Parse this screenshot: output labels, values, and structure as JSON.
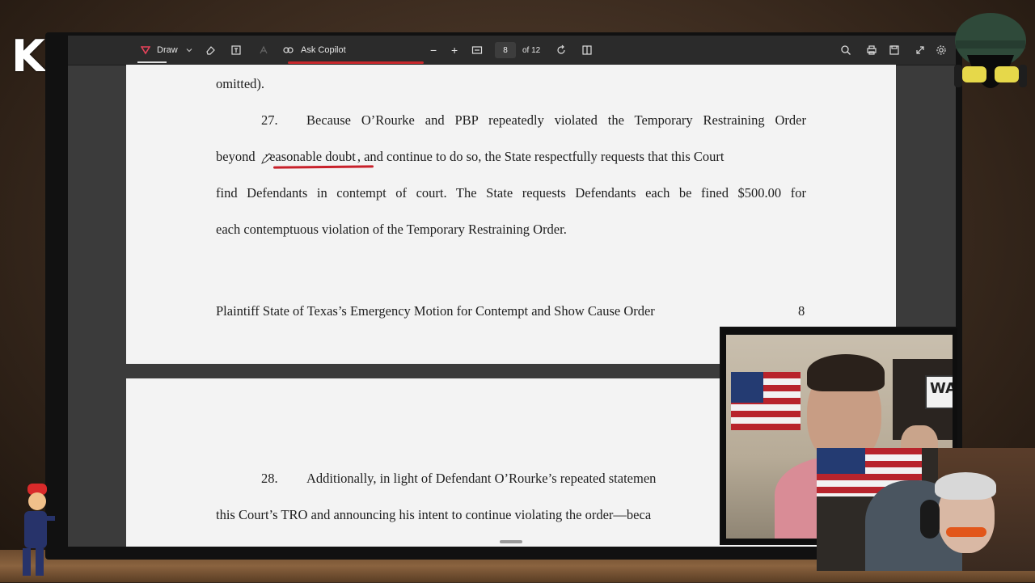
{
  "overlay": {
    "brand": "KICK"
  },
  "toolbar": {
    "draw_label": "Draw",
    "copilot_label": "Ask Copilot",
    "zoom_out": "−",
    "zoom_in": "+",
    "current_page": "8",
    "total_pages": "of 12"
  },
  "document": {
    "line_omitted": "omitted).",
    "para27_number": "27.",
    "para27_line1": "Because O’Rourke and PBP repeatedly violated the Temporary Restraining Order",
    "para27_line2_a": "beyond",
    "para27_line2_b": "reasonable doubt",
    "para27_line2_c": ", and continue to do so, the State respectfully requests that this Court",
    "para27_line3": "find Defendants in contempt of court. The State requests Defendants each be fined $500.00 for",
    "para27_line4": "each contemptuous violation of the Temporary Restraining Order.",
    "footer_title": "Plaintiff State of Texas’s Emergency Motion for Contempt and Show Cause Order",
    "footer_page": "8",
    "para28_number": "28.",
    "para28_line1": "Additionally, in light of Defendant O’Rourke’s repeated statemen",
    "para28_line2": "this Court’s TRO and announcing his intent to continue violating the order—beca"
  },
  "webcam": {
    "sign_text": "WATC"
  },
  "colors": {
    "accent_red": "#c8202a",
    "toolbar_bg": "#2b2b2b",
    "page_bg": "#f3f3f3"
  }
}
